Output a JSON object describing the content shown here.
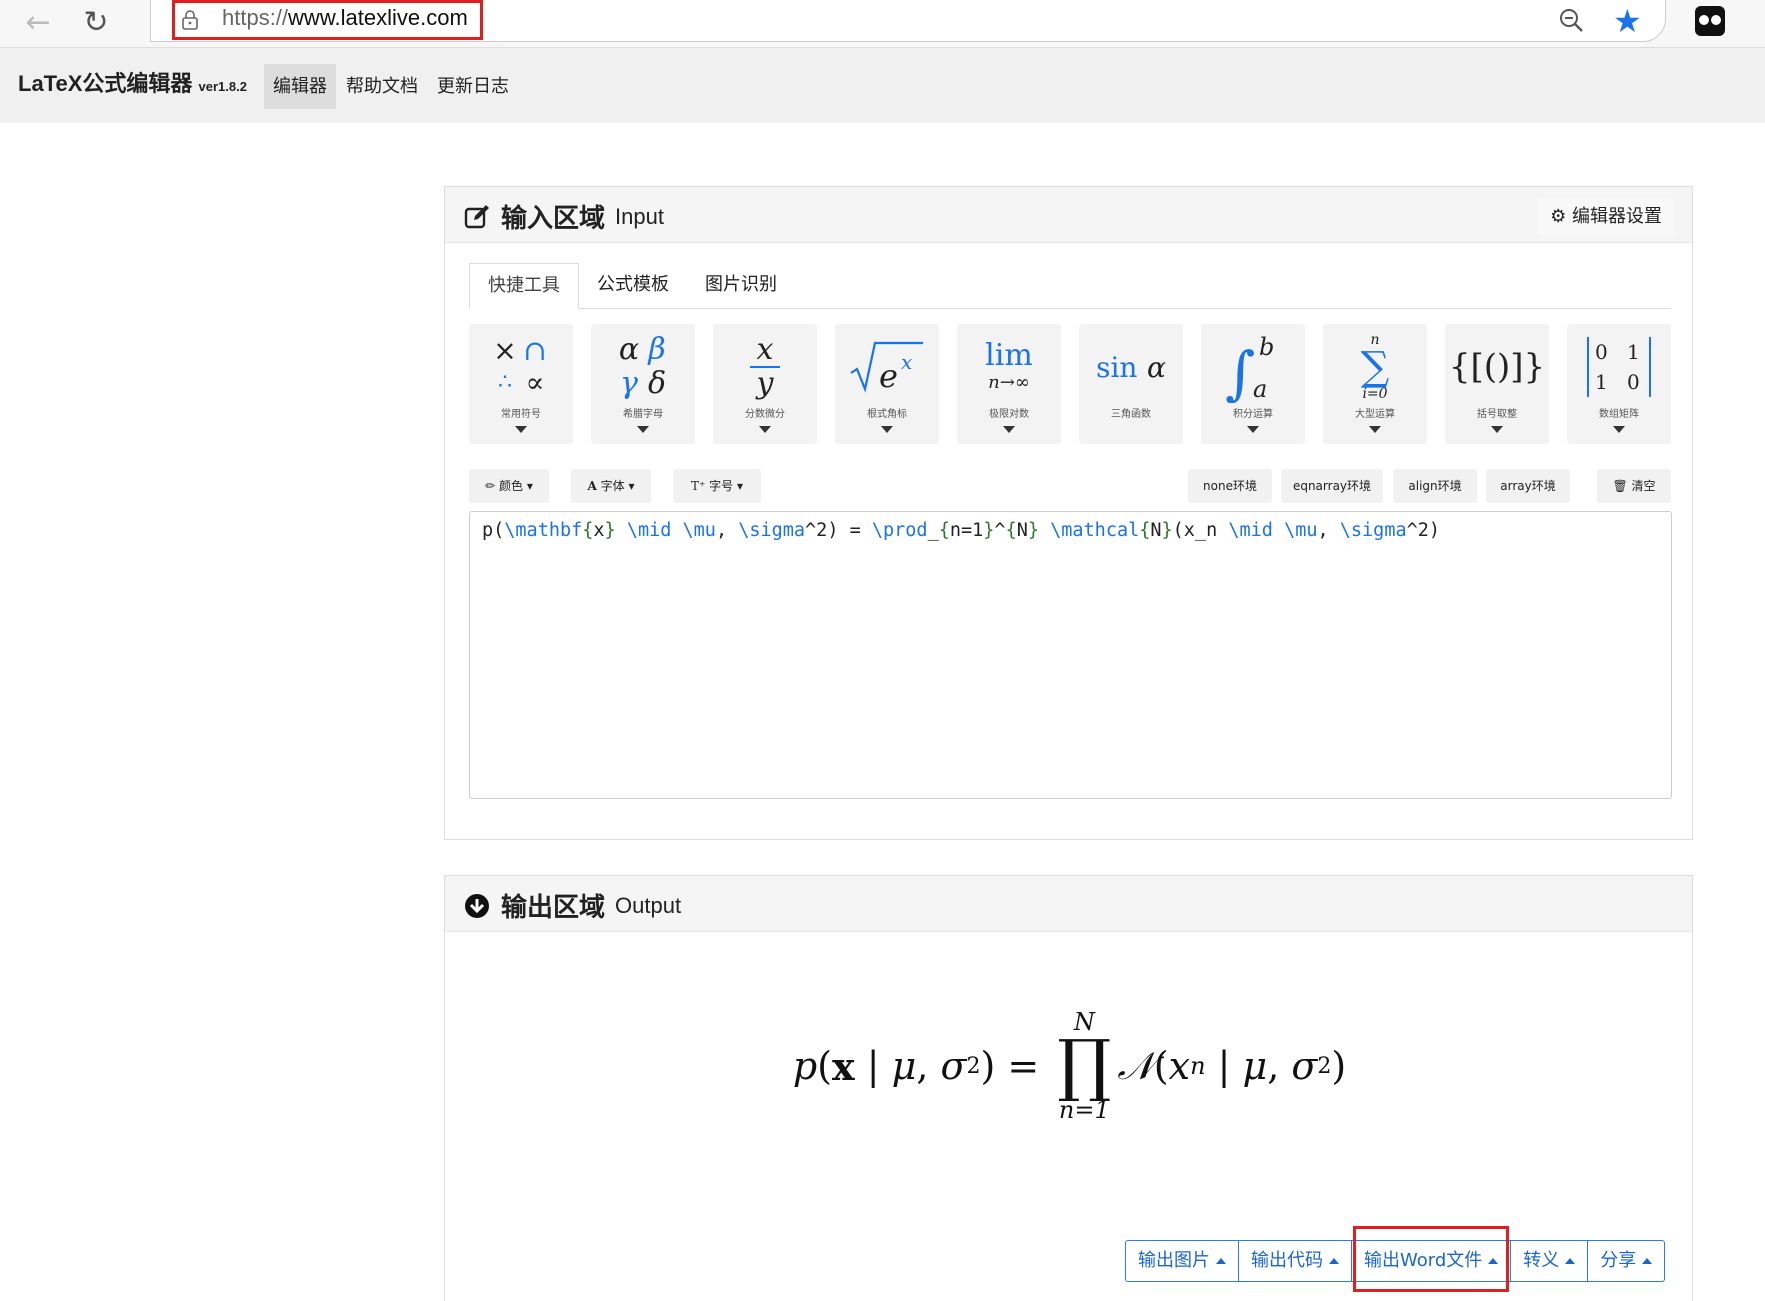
{
  "browser": {
    "url_prefix": "https://",
    "url_domain": "www.latexlive.com"
  },
  "site": {
    "brand": "LaTeX公式编辑器",
    "version": "ver1.8.2",
    "nav": [
      "编辑器",
      "帮助文档",
      "更新日志"
    ]
  },
  "input_panel": {
    "title": "输入区域",
    "title_en": "Input",
    "settings_label": "编辑器设置",
    "tabs": [
      "快捷工具",
      "公式模板",
      "图片识别"
    ],
    "tools": [
      "常用符号",
      "希腊字母",
      "分数微分",
      "根式角标",
      "极限对数",
      "三角函数",
      "积分运算",
      "大型运算",
      "括号取整",
      "数组矩阵"
    ],
    "format_buttons": [
      "颜色",
      "字体",
      "字号"
    ],
    "env_buttons": [
      "none环境",
      "eqnarray环境",
      "align环境",
      "array环境"
    ],
    "clear_label": "清空",
    "editor_code": "p(\\mathbf{x} \\mid \\mu, \\sigma^2) = \\prod_{n=1}^{N} \\mathcal{N}(x_n \\mid \\mu, \\sigma^2)"
  },
  "output_panel": {
    "title": "输出区域",
    "title_en": "Output",
    "buttons": [
      "输出图片",
      "输出代码",
      "输出Word文件",
      "转义",
      "分享"
    ]
  },
  "colors": {
    "accent": "#1a73e8",
    "highlight": "#e02020"
  }
}
